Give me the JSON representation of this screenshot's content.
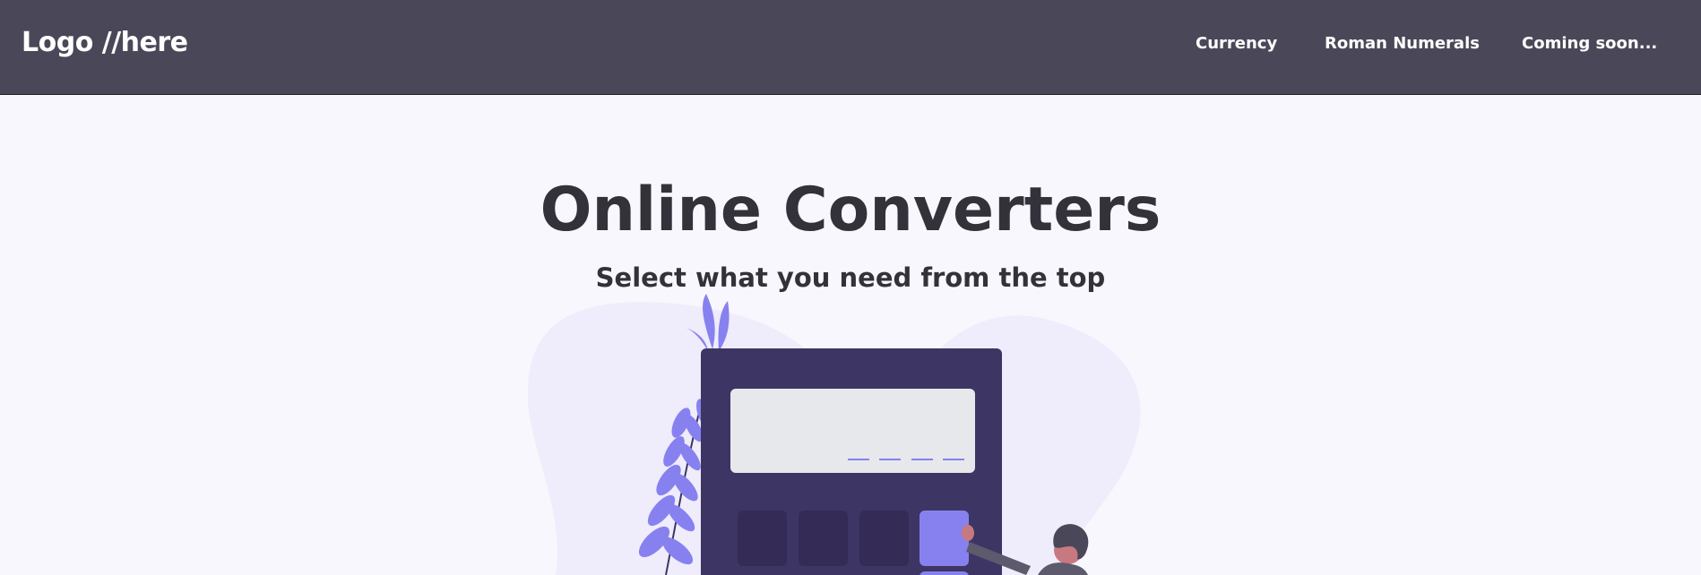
{
  "header": {
    "logo": "Logo //here",
    "nav": {
      "currency": "Currency",
      "roman": "Roman Numerals",
      "soon": "Coming soon..."
    }
  },
  "hero": {
    "title": "Online Converters",
    "subtitle": "Select what you need from the top"
  },
  "colors": {
    "navbar_bg": "#4a4858",
    "page_bg": "#f8f7fd",
    "text_dark": "#33323a",
    "calculator_body": "#3d3563",
    "accent": "#8781f0",
    "blob": "#efecfb"
  }
}
